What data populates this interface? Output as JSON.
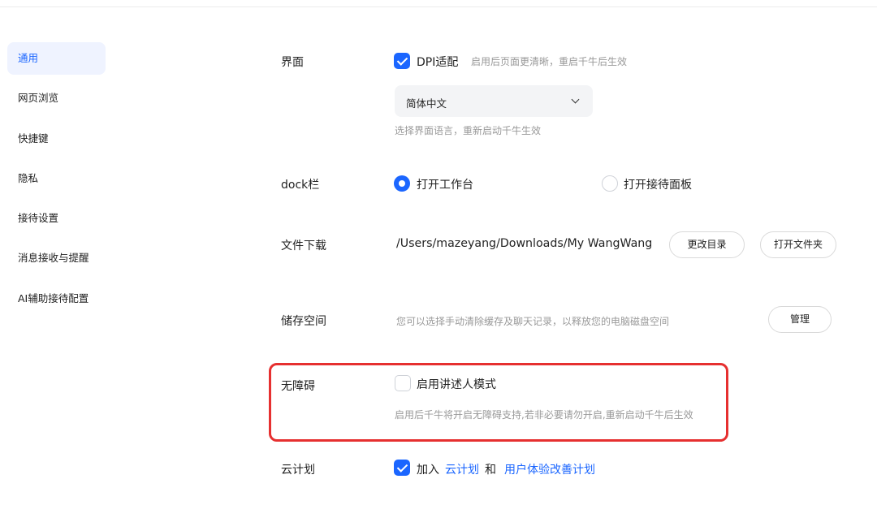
{
  "sidebar": {
    "items": [
      {
        "label": "通用",
        "active": true
      },
      {
        "label": "网页浏览"
      },
      {
        "label": "快捷键"
      },
      {
        "label": "隐私"
      },
      {
        "label": "接待设置"
      },
      {
        "label": "消息接收与提醒"
      },
      {
        "label": "AI辅助接待配置"
      }
    ]
  },
  "interface": {
    "label": "界面",
    "dpi_label": "DPI适配",
    "dpi_checked": true,
    "dpi_hint": "启用后页面更清晰，重启千牛后生效",
    "language_value": "简体中文",
    "language_hint": "选择界面语言，重新启动千牛生效"
  },
  "dock": {
    "label": "dock栏",
    "option1": "打开工作台",
    "option2": "打开接待面板",
    "selected": "打开工作台"
  },
  "download": {
    "label": "文件下载",
    "path": "/Users/mazeyang/Downloads/My WangWang",
    "change_btn": "更改目录",
    "open_btn": "打开文件夹"
  },
  "storage": {
    "label": "储存空间",
    "hint": "您可以选择手动清除缓存及聊天记录，以释放您的电脑磁盘空间",
    "manage_btn": "管理"
  },
  "accessibility": {
    "label": "无障碍",
    "narrator_label": "启用讲述人模式",
    "narrator_checked": false,
    "hint": "启用后千牛将开启无障碍支持,若非必要请勿开启,重新启动千牛后生效"
  },
  "cloud": {
    "label": "云计划",
    "join_text": "加入",
    "link1": "云计划",
    "and_text": "和",
    "link2": "用户体验改善计划",
    "checked": true
  },
  "colors": {
    "accent": "#1b66ff",
    "highlight": "#e63030"
  }
}
